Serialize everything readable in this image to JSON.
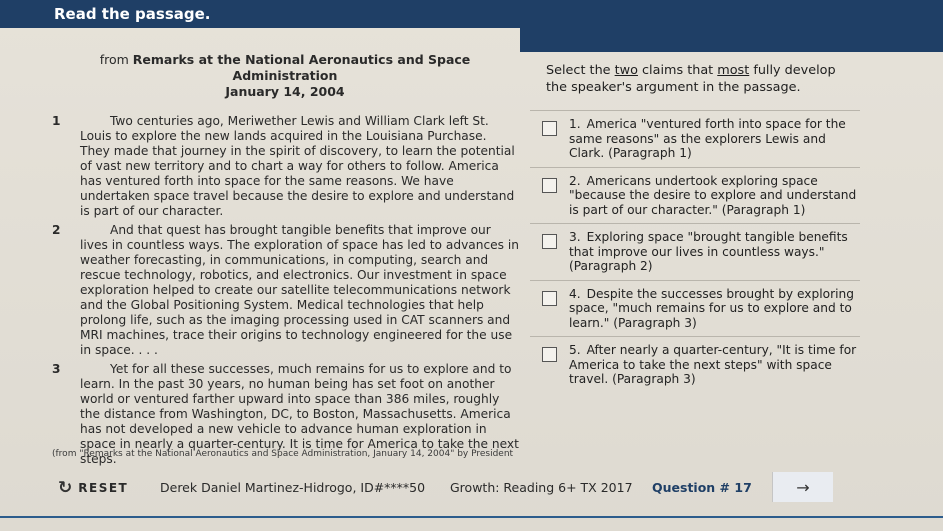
{
  "header": {
    "title": "Read the passage."
  },
  "passage": {
    "source_prefix": "from ",
    "source_title": "Remarks at the National Aeronautics and Space Administration",
    "date": "January 14, 2004",
    "paragraphs": [
      {
        "num": "1",
        "text": "Two centuries ago, Meriwether Lewis and William Clark left St. Louis to explore the new lands acquired in the Louisiana Purchase. They made that journey in the spirit of discovery, to learn the potential of vast new territory and to chart a way for others to follow. America has ventured forth into space for the same reasons. We have undertaken space travel because the desire to explore and understand is part of our character."
      },
      {
        "num": "2",
        "text": "And that quest has brought tangible benefits that improve our lives in countless ways. The exploration of space has led to advances in weather forecasting, in communications, in computing, search and rescue technology, robotics, and electronics. Our investment in space exploration helped to create our satellite telecommunications network and the Global Positioning System. Medical technologies that help prolong life, such as the imaging processing used in CAT scanners and MRI machines, trace their origins to technology engineered for the use in space. . . ."
      },
      {
        "num": "3",
        "text": "Yet for all these successes, much remains for us to explore and to learn. In the past 30 years, no human being has set foot on another world or ventured farther upward into space than 386 miles, roughly the distance from Washington, DC, to Boston, Massachusetts. America has not developed a new vehicle to advance human exploration in space in nearly a quarter-century. It is time for America to take the next steps."
      }
    ],
    "citation": "(from \"Remarks at the National Aeronautics and Space Administration, January 14, 2004\" by President"
  },
  "question": {
    "prompt_pre": "Select the ",
    "prompt_u1": "two",
    "prompt_mid": " claims that ",
    "prompt_u2": "most",
    "prompt_post": " fully develop the speaker's argument in the passage.",
    "choices": [
      {
        "num": "1.",
        "text": "America \"ventured forth into space for the same reasons\" as the explorers Lewis and Clark. (Paragraph 1)"
      },
      {
        "num": "2.",
        "text": "Americans undertook exploring space \"because the desire to explore and understand is part of our character.\" (Paragraph 1)"
      },
      {
        "num": "3.",
        "text": "Exploring space \"brought tangible benefits that improve our lives in countless ways.\" (Paragraph 2)"
      },
      {
        "num": "4.",
        "text": "Despite the successes brought by exploring space, \"much remains for us to explore and to learn.\" (Paragraph 3)"
      },
      {
        "num": "5.",
        "text": "After nearly a quarter-century, \"It is time for America to take the next steps\" with space travel. (Paragraph 3)"
      }
    ]
  },
  "footer": {
    "reset_label": "RESET",
    "reset_icon": "refresh-icon",
    "student": "Derek Daniel Martinez-Hidrogo, ID#****50",
    "growth": "Growth: Reading 6+ TX 2017",
    "question_number": "Question # 17",
    "next_icon": "arrow-right-icon"
  },
  "colors": {
    "header": "#1f3f66",
    "background": "#e2ded5",
    "accent_line": "#2c5c8c"
  }
}
